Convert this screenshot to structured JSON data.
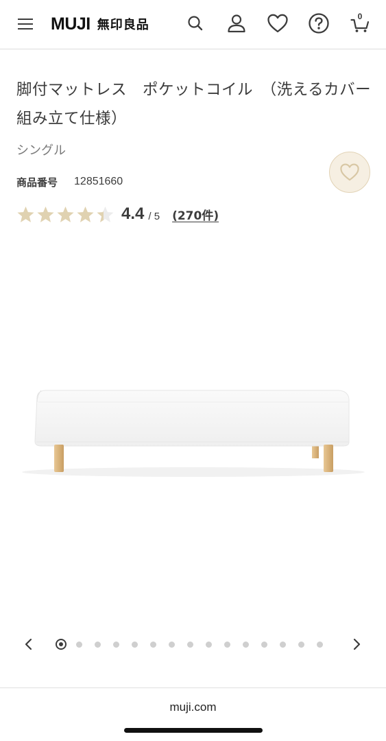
{
  "header": {
    "menu_icon": "hamburger-menu-icon",
    "logo_en": "MUJI",
    "logo_jp": "無印良品",
    "icons": [
      "search-icon",
      "account-icon",
      "heart-icon",
      "help-icon",
      "cart-icon"
    ],
    "cart_count": "0"
  },
  "product": {
    "title": "脚付マットレス　ポケットコイル　（洗えるカバー　組み立て仕様）",
    "variant": "シングル",
    "code_label": "商品番号",
    "code_value": "12851660",
    "rating_value": 4.4,
    "rating_text": "4.4",
    "rating_max": "/ 5",
    "review_count": "(270件)",
    "favorite_icon": "heart-outline-icon"
  },
  "carousel": {
    "total_slides": 15,
    "active_index": 0,
    "prev_icon": "chevron-left-icon",
    "next_icon": "chevron-right-icon"
  },
  "browser": {
    "url": "muji.com"
  },
  "colors": {
    "star_filled": "#e0d2b1",
    "star_empty": "#ececec",
    "favorite_bg": "#f6efe2",
    "favorite_heart": "#d8c7a4",
    "leg_wood": "#d9b37b"
  }
}
